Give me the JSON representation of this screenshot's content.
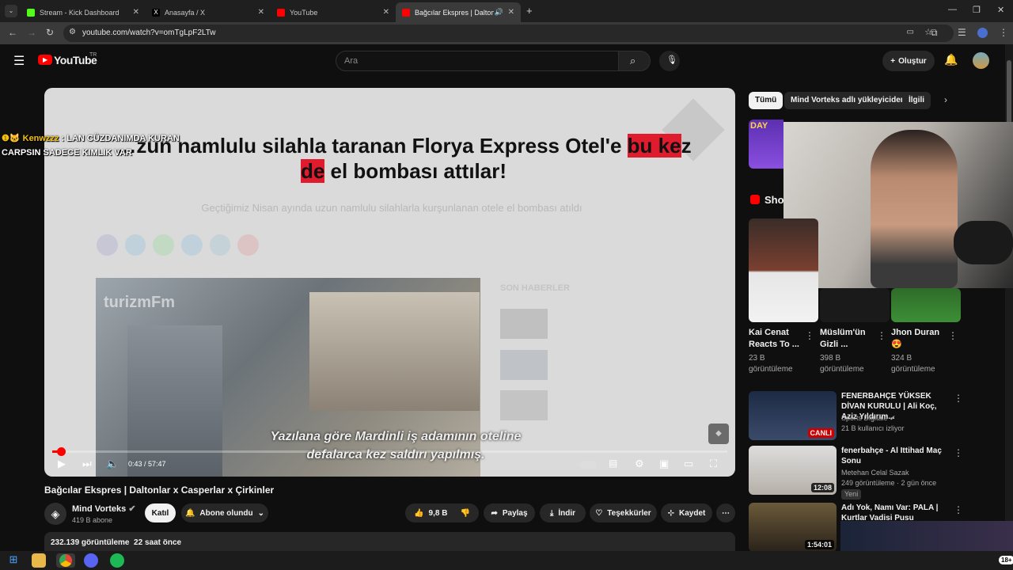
{
  "browser": {
    "tabs": [
      {
        "label": "Stream - Kick Dashboard",
        "color": "#53fc18"
      },
      {
        "label": "Anasayfa / X",
        "color": "#ffffff"
      },
      {
        "label": "YouTube",
        "color": "#ff0000"
      },
      {
        "label": "Bağcılar Ekspres | Daltonlar",
        "color": "#ff0000"
      }
    ],
    "url": "youtube.com/watch?v=omTgLpF2LTw"
  },
  "youtube": {
    "logo": "YouTube",
    "region": "TR",
    "search_placeholder": "Ara",
    "create_label": "Oluştur"
  },
  "video": {
    "headline_a": "…zun namlulu silahla taranan Florya Express Otel'e",
    "headline_hl1": "bu ke",
    "headline_b": "z",
    "headline_hl2": "de",
    "headline_c": " el bombası attılar!",
    "subheadline": "Geçtiğimiz Nisan ayında uzun namlulu silahlarla kurşunlanan otele el bombası atıldı",
    "photo_logo": "turizmFm",
    "sidebar_heading": "SON HABERLER",
    "caption_line1": "Yazılana göre Mardinli iş adamının oteline",
    "caption_line2": "defalarca kez saldırı yapılmış.",
    "time": "0:43 / 57:47",
    "progress": 0.0125,
    "title": "Bağcılar Ekspres | Daltonlar x Casperlar x Çirkinler"
  },
  "chat_overlay": {
    "user": "Kenwzzz",
    "line1": "LAN CÜZDANIMDA KURAN",
    "line2": "CARPSIN SADECE KIMLIK VAR"
  },
  "channel": {
    "name": "Mind Vorteks",
    "subs": "419 B abone",
    "join": "Katıl",
    "subscribed": "Abone olundu",
    "likes": "9,8 B",
    "share": "Paylaş",
    "download": "İndir",
    "thanks": "Teşekkürler",
    "save": "Kaydet"
  },
  "description": {
    "views": "232.139 görüntüleme",
    "date": "22 saat önce"
  },
  "sidebar": {
    "chips": [
      "Tümü",
      "Mind Vorteks adlı yükleyiciden",
      "İlgili"
    ],
    "shorts_label": "Sho",
    "shorts": [
      {
        "title1": "Kai Cenat",
        "title2": "Reacts To ...",
        "views1": "23 B",
        "views2": "görüntüleme"
      },
      {
        "title1": "Müslüm'ün",
        "title2": "Gizli ...",
        "views1": "398 B",
        "views2": "görüntüleme"
      },
      {
        "title1": "Jhon Duran",
        "title2": "😍",
        "views1": "324 B",
        "views2": "görüntüleme"
      }
    ],
    "recs": [
      {
        "title": "FENERBAHÇE YÜKSEK DİVAN KURULU | Ali Koç, Aziz Yıldırım...",
        "channel": "Sports Digitale",
        "meta": "21 B kullanıcı izliyor",
        "badge": "CANLI"
      },
      {
        "title": "fenerbahçe - Al Ittihad Maç Sonu",
        "channel": "Metehan Celal Sazak",
        "meta": "249 görüntüleme · 2 gün önce",
        "badge": "Yeni",
        "duration": "12:08"
      },
      {
        "title": "Adı Yok, Namı Var: PALA | Kurtlar Vadisi Pusu",
        "channel": "",
        "meta": "",
        "duration": "1:54:01"
      }
    ]
  },
  "taskbar": {
    "notif_count": "18+"
  }
}
